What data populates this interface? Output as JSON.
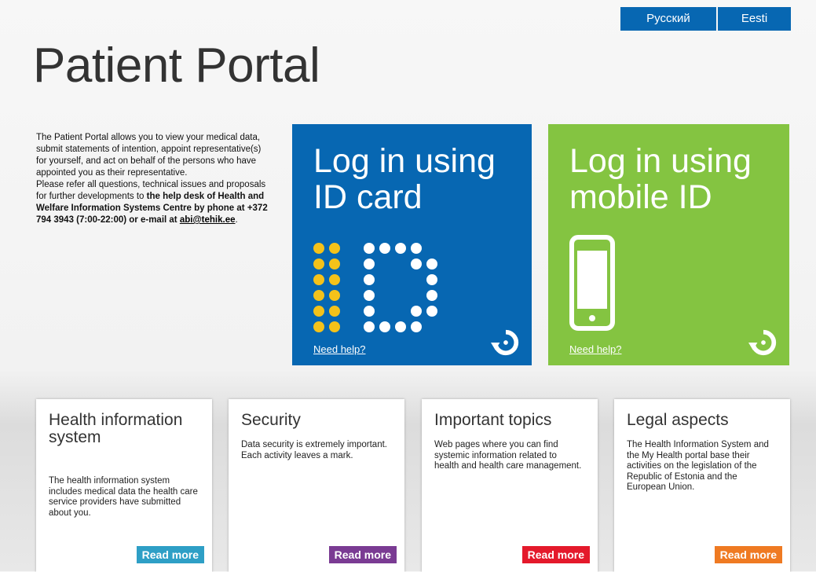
{
  "languages": {
    "ru": "Русский",
    "et": "Eesti"
  },
  "title": "Patient Portal",
  "intro": {
    "p1": "The Patient Portal allows you to view your medical data, submit statements of intention, appoint representative(s) for yourself, and act on behalf of the persons who have appointed you as their representative.",
    "p2_start": "Please refer all questions, technical issues and proposals for further developments to ",
    "p2_bold": "the help desk of Health and Welfare Information Systems Centre by phone at +372 794 3943 (7:00-22:00) or e-mail at ",
    "email": "abi@tehik.ee",
    "end": "."
  },
  "login_id": {
    "title_line1": "Log in using",
    "title_line2": "ID card",
    "help": "Need help?",
    "color": "#0767b2"
  },
  "login_mobile": {
    "title_line1": "Log in using",
    "title_line2": "mobile ID",
    "help": "Need help?",
    "color": "#84c441"
  },
  "cards": [
    {
      "title": "Health information system",
      "text": "The health information system includes medical data the health care service providers have submitted about you.",
      "button": "Read more",
      "color": "#2e9fc6"
    },
    {
      "title": "Security",
      "text": "Data security is extremely important. Each activity leaves a mark.",
      "button": "Read more",
      "color": "#7a3b93"
    },
    {
      "title": "Important topics",
      "text": "Web pages where you can find systemic information related to health and health care management.",
      "button": "Read more",
      "color": "#e4192b"
    },
    {
      "title": "Legal aspects",
      "text": "The Health Information System and the My Health portal base their activities on the legislation of the Republic of Estonia and the European Union.",
      "button": "Read more",
      "color": "#ef7a22"
    }
  ]
}
